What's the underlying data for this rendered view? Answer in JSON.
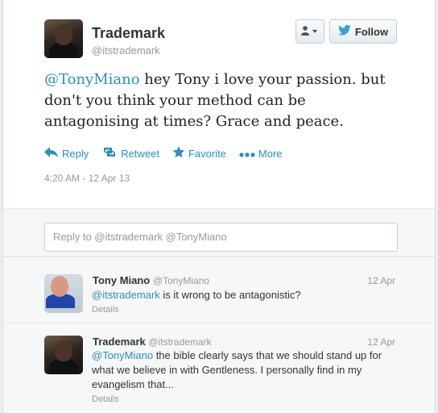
{
  "tweet": {
    "name": "Trademark",
    "handle": "@itstrademark",
    "mention": "@TonyMiano",
    "text": "  hey Tony i love your passion. but don't you think your method can be antagonising at times? Grace and peace.",
    "timestamp": "4:20 AM - 12 Apr 13",
    "actions": {
      "reply": "Reply",
      "retweet": "Retweet",
      "favorite": "Favorite",
      "more": "More"
    },
    "follow_label": "Follow"
  },
  "reply_box": {
    "placeholder": "Reply to @itstrademark @TonyMiano"
  },
  "replies": [
    {
      "name": "Tony Miano",
      "handle": "@TonyMiano",
      "date": "12 Apr",
      "mention": "@itstrademark",
      "text": " is it wrong to be antagonistic?",
      "details": "Details"
    },
    {
      "name": "Trademark",
      "handle": "@itstrademark",
      "date": "12 Apr",
      "mention": "@TonyMiano",
      "text": " the bible clearly says that we should stand up for what we believe in with Gentleness. I personally find in my evangelism that...",
      "details": "Details"
    }
  ],
  "colors": {
    "accent": "#2b8fbd",
    "muted": "#999999",
    "background": "#e9eef1"
  }
}
